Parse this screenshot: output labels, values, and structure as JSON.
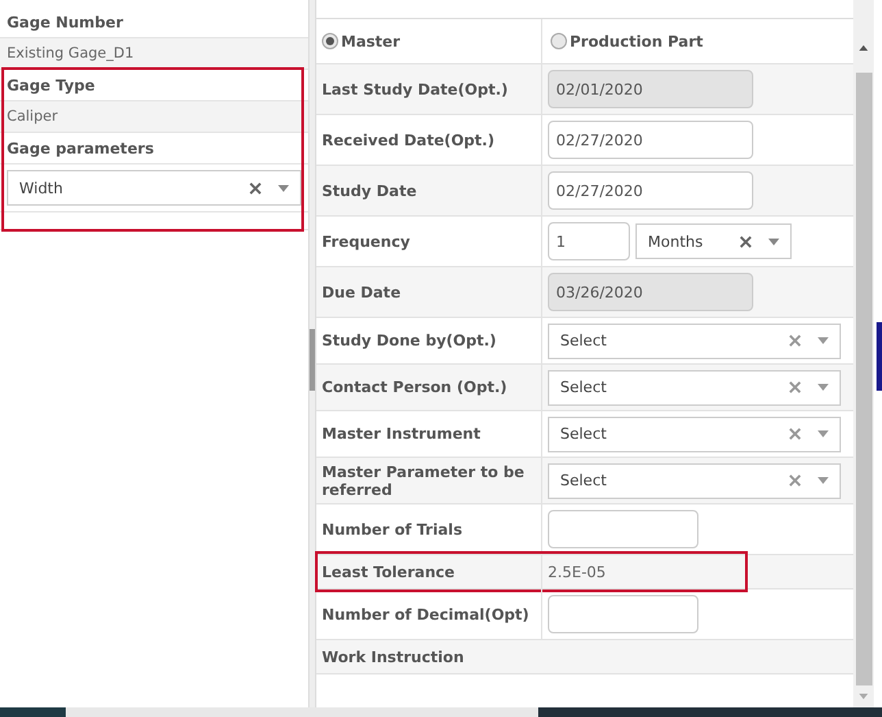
{
  "left_panel": {
    "fields": [
      {
        "label": "Gage Number",
        "value": "Existing Gage_D1"
      },
      {
        "label": "Gage Type",
        "value": "Caliper"
      }
    ],
    "parameters": {
      "label": "Gage parameters",
      "value": "Width"
    },
    "highlighted": true
  },
  "form": {
    "rows": [
      {
        "kind": "radio",
        "options": [
          {
            "label": "Master",
            "selected": true
          },
          {
            "label": "Production Part",
            "selected": false
          }
        ]
      },
      {
        "kind": "input",
        "label": "Last Study Date(Opt.)",
        "value": "02/01/2020",
        "disabled": true
      },
      {
        "kind": "input",
        "label": "Received Date(Opt.)",
        "value": "02/27/2020",
        "disabled": false
      },
      {
        "kind": "input",
        "label": "Study Date",
        "value": "02/27/2020",
        "disabled": false
      },
      {
        "kind": "frequency",
        "label": "Frequency",
        "value": "1",
        "unit": "Months"
      },
      {
        "kind": "input",
        "label": "Due Date",
        "value": "03/26/2020",
        "disabled": true
      },
      {
        "kind": "select",
        "label": "Study Done by(Opt.)",
        "value": "Select"
      },
      {
        "kind": "select",
        "label": "Contact Person (Opt.)",
        "value": "Select"
      },
      {
        "kind": "select",
        "label": "Master Instrument",
        "value": "Select"
      },
      {
        "kind": "select",
        "label": "Master Parameter to be referred",
        "value": "Select"
      },
      {
        "kind": "short",
        "label": "Number of Trials"
      },
      {
        "kind": "text",
        "label": "Least Tolerance",
        "value": "2.5E-05",
        "highlighted": true
      },
      {
        "kind": "short",
        "label": "Number of Decimal(Opt)"
      },
      {
        "kind": "heading",
        "label": "Work Instruction"
      }
    ]
  }
}
